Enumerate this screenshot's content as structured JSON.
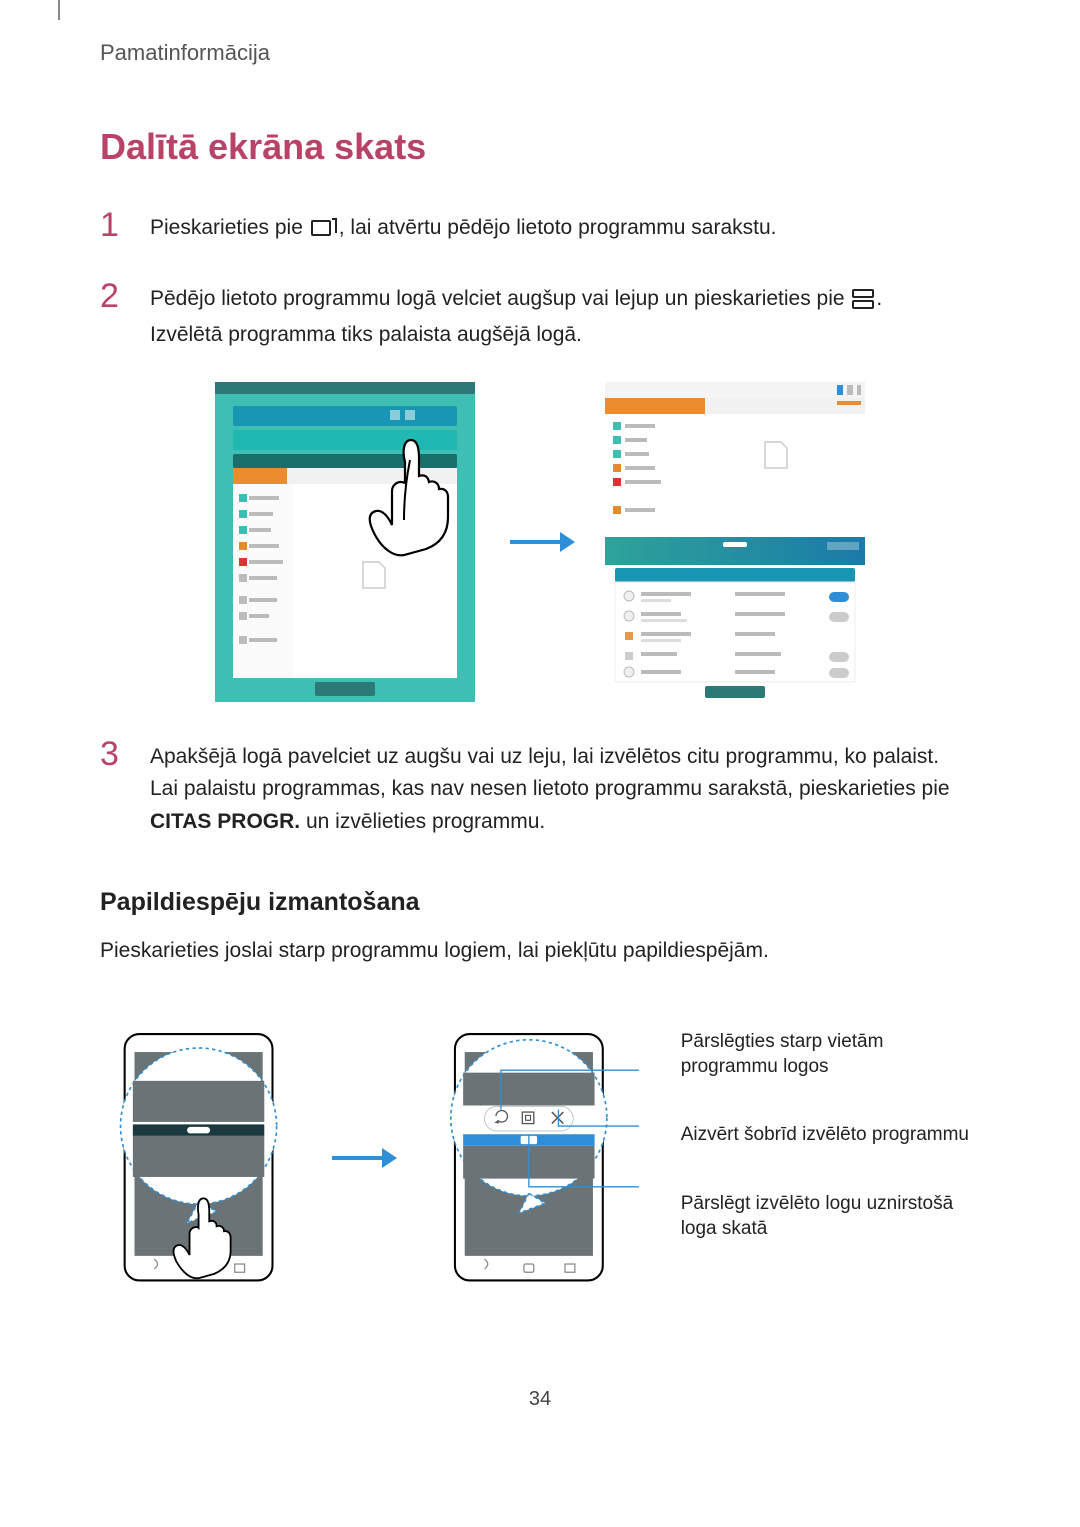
{
  "header": "Pamatinformācija",
  "mainHeading": "Dalītā ekrāna skats",
  "steps": {
    "s1": {
      "num": "1",
      "pre": "Pieskarieties pie ",
      "post": ", lai atvērtu pēdējo lietoto programmu sarakstu."
    },
    "s2": {
      "num": "2",
      "line1_pre": "Pēdējo lietoto programmu logā velciet augšup vai lejup un pieskarieties pie ",
      "line1_post": ".",
      "line2": "Izvēlētā programma tiks palaista augšējā logā."
    },
    "s3": {
      "num": "3",
      "line1": "Apakšējā logā pavelciet uz augšu vai uz leju, lai izvēlētos citu programmu, ko palaist.",
      "line2_pre": "Lai palaistu programmas, kas nav nesen lietoto programmu sarakstā, pieskarieties pie ",
      "line2_bold": "CITAS PROGR.",
      "line2_post": " un izvēlieties programmu."
    }
  },
  "subHeading": "Papildiespēju izmantošana",
  "subBody": "Pieskarieties joslai starp programmu logiem, lai piekļūtu papildiespējām.",
  "callouts": {
    "c1": "Pārslēgties starp vietām programmu logos",
    "c2": "Aizvērt šobrīd izvēlēto programmu",
    "c3": "Pārslēgt izvēlēto logu uznirstošā loga skatā"
  },
  "pageNum": "34"
}
